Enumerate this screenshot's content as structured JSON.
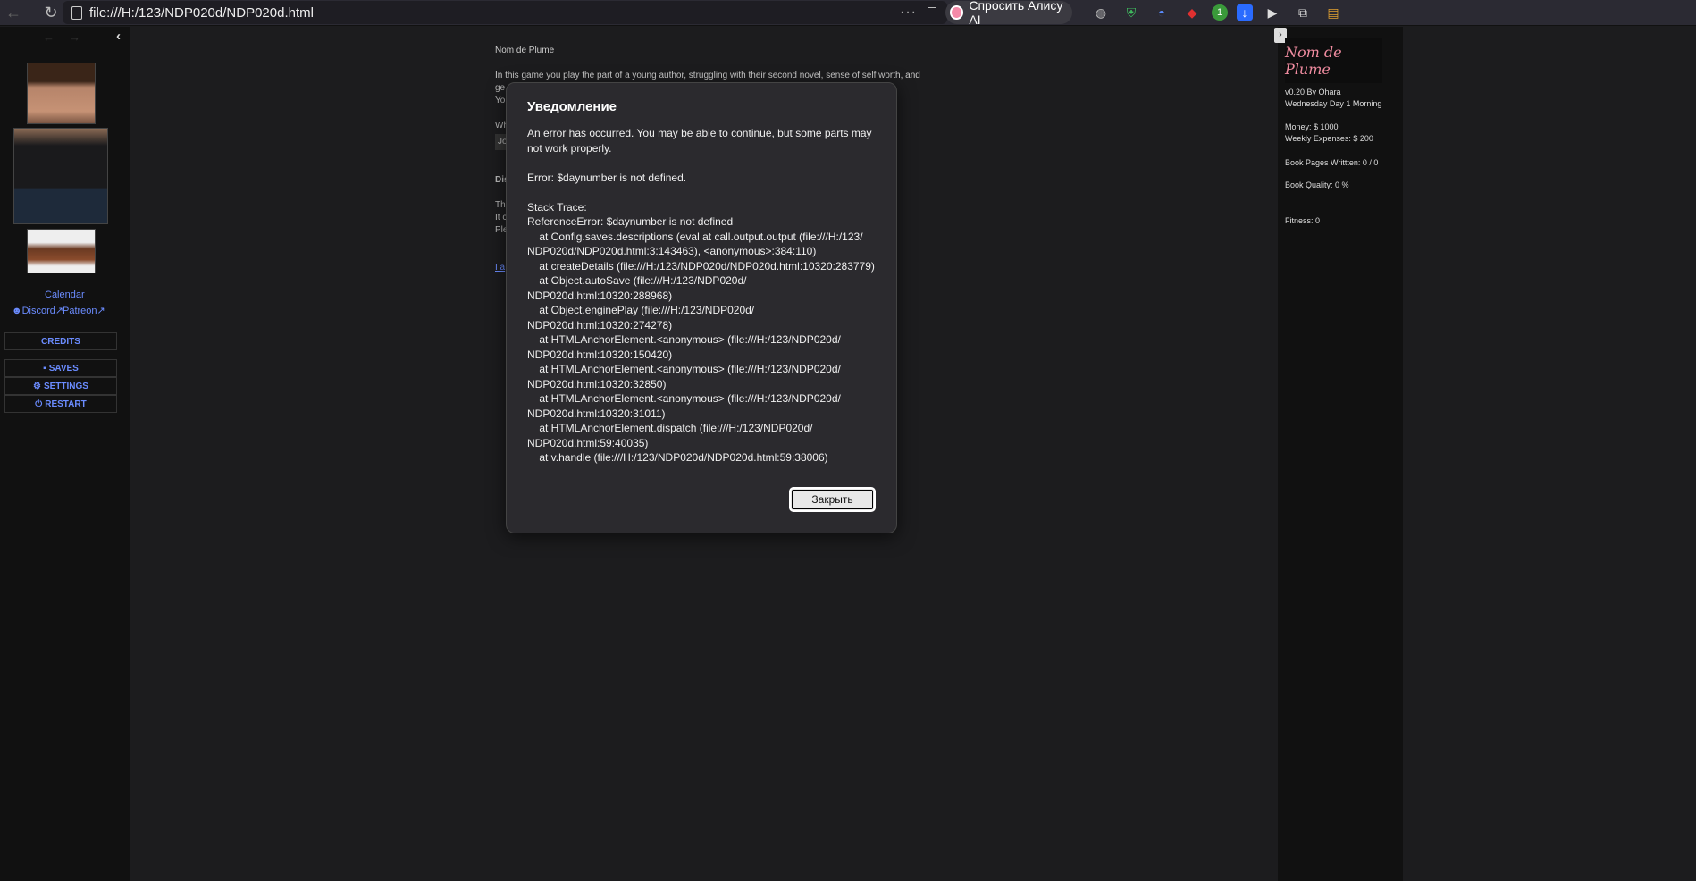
{
  "browser": {
    "url": "file:///H:/123/NDP020d/NDP020d.html",
    "alice_label": "Спросить Алису AI",
    "ext_badge_count": "1"
  },
  "left_sidebar": {
    "calendar_label": "Calendar",
    "discord_label": "Discord",
    "patreon_label": "Patreon",
    "credits_label": "CREDITS",
    "saves_label": "SAVES",
    "settings_label": "SETTINGS",
    "restart_label": "RESTART"
  },
  "passage": {
    "title": "Nom de Plume",
    "intro": "In this game you play the part of a young author, struggling with their second novel, sense of self worth, and",
    "frag_ge": "ge",
    "frag_yo": "Yo",
    "frag_wh": "Wh",
    "frag_jo": "Jo",
    "frag_dis": "Dis",
    "frag_thi": "Thi",
    "frag_itc": "It c",
    "frag_ple": "Ple",
    "frag_link": "I a"
  },
  "right_sidebar": {
    "logo_text": "Nom de Plume",
    "version": "v0.20 By Ohara",
    "day": "Wednesday Day 1 Morning",
    "money": "Money: $ 1000",
    "expenses": "Weekly Expenses: $ 200",
    "pages": "Book Pages Writtten: 0 / 0",
    "quality": "Book Quality: 0 %",
    "fitness": "Fitness: 0"
  },
  "modal": {
    "title": "Уведомление",
    "body": "An error has occurred. You may be able to continue, but some parts may not work properly.\n\nError: $daynumber is not defined.\n\nStack Trace:\nReferenceError: $daynumber is not defined\n    at Config.saves.descriptions (eval at call.output.output (file:///H:/123/\nNDP020d/NDP020d.html:3:143463), <anonymous>:384:110)\n    at createDetails (file:///H:/123/NDP020d/NDP020d.html:10320:283779)\n    at Object.autoSave (file:///H:/123/NDP020d/\nNDP020d.html:10320:288968)\n    at Object.enginePlay (file:///H:/123/NDP020d/\nNDP020d.html:10320:274278)\n    at HTMLAnchorElement.<anonymous> (file:///H:/123/NDP020d/\nNDP020d.html:10320:150420)\n    at HTMLAnchorElement.<anonymous> (file:///H:/123/NDP020d/\nNDP020d.html:10320:32850)\n    at HTMLAnchorElement.<anonymous> (file:///H:/123/NDP020d/\nNDP020d.html:10320:31011)\n    at HTMLAnchorElement.dispatch (file:///H:/123/NDP020d/\nNDP020d.html:59:40035)\n    at v.handle (file:///H:/123/NDP020d/NDP020d.html:59:38006)",
    "close_label": "Закрыть"
  }
}
